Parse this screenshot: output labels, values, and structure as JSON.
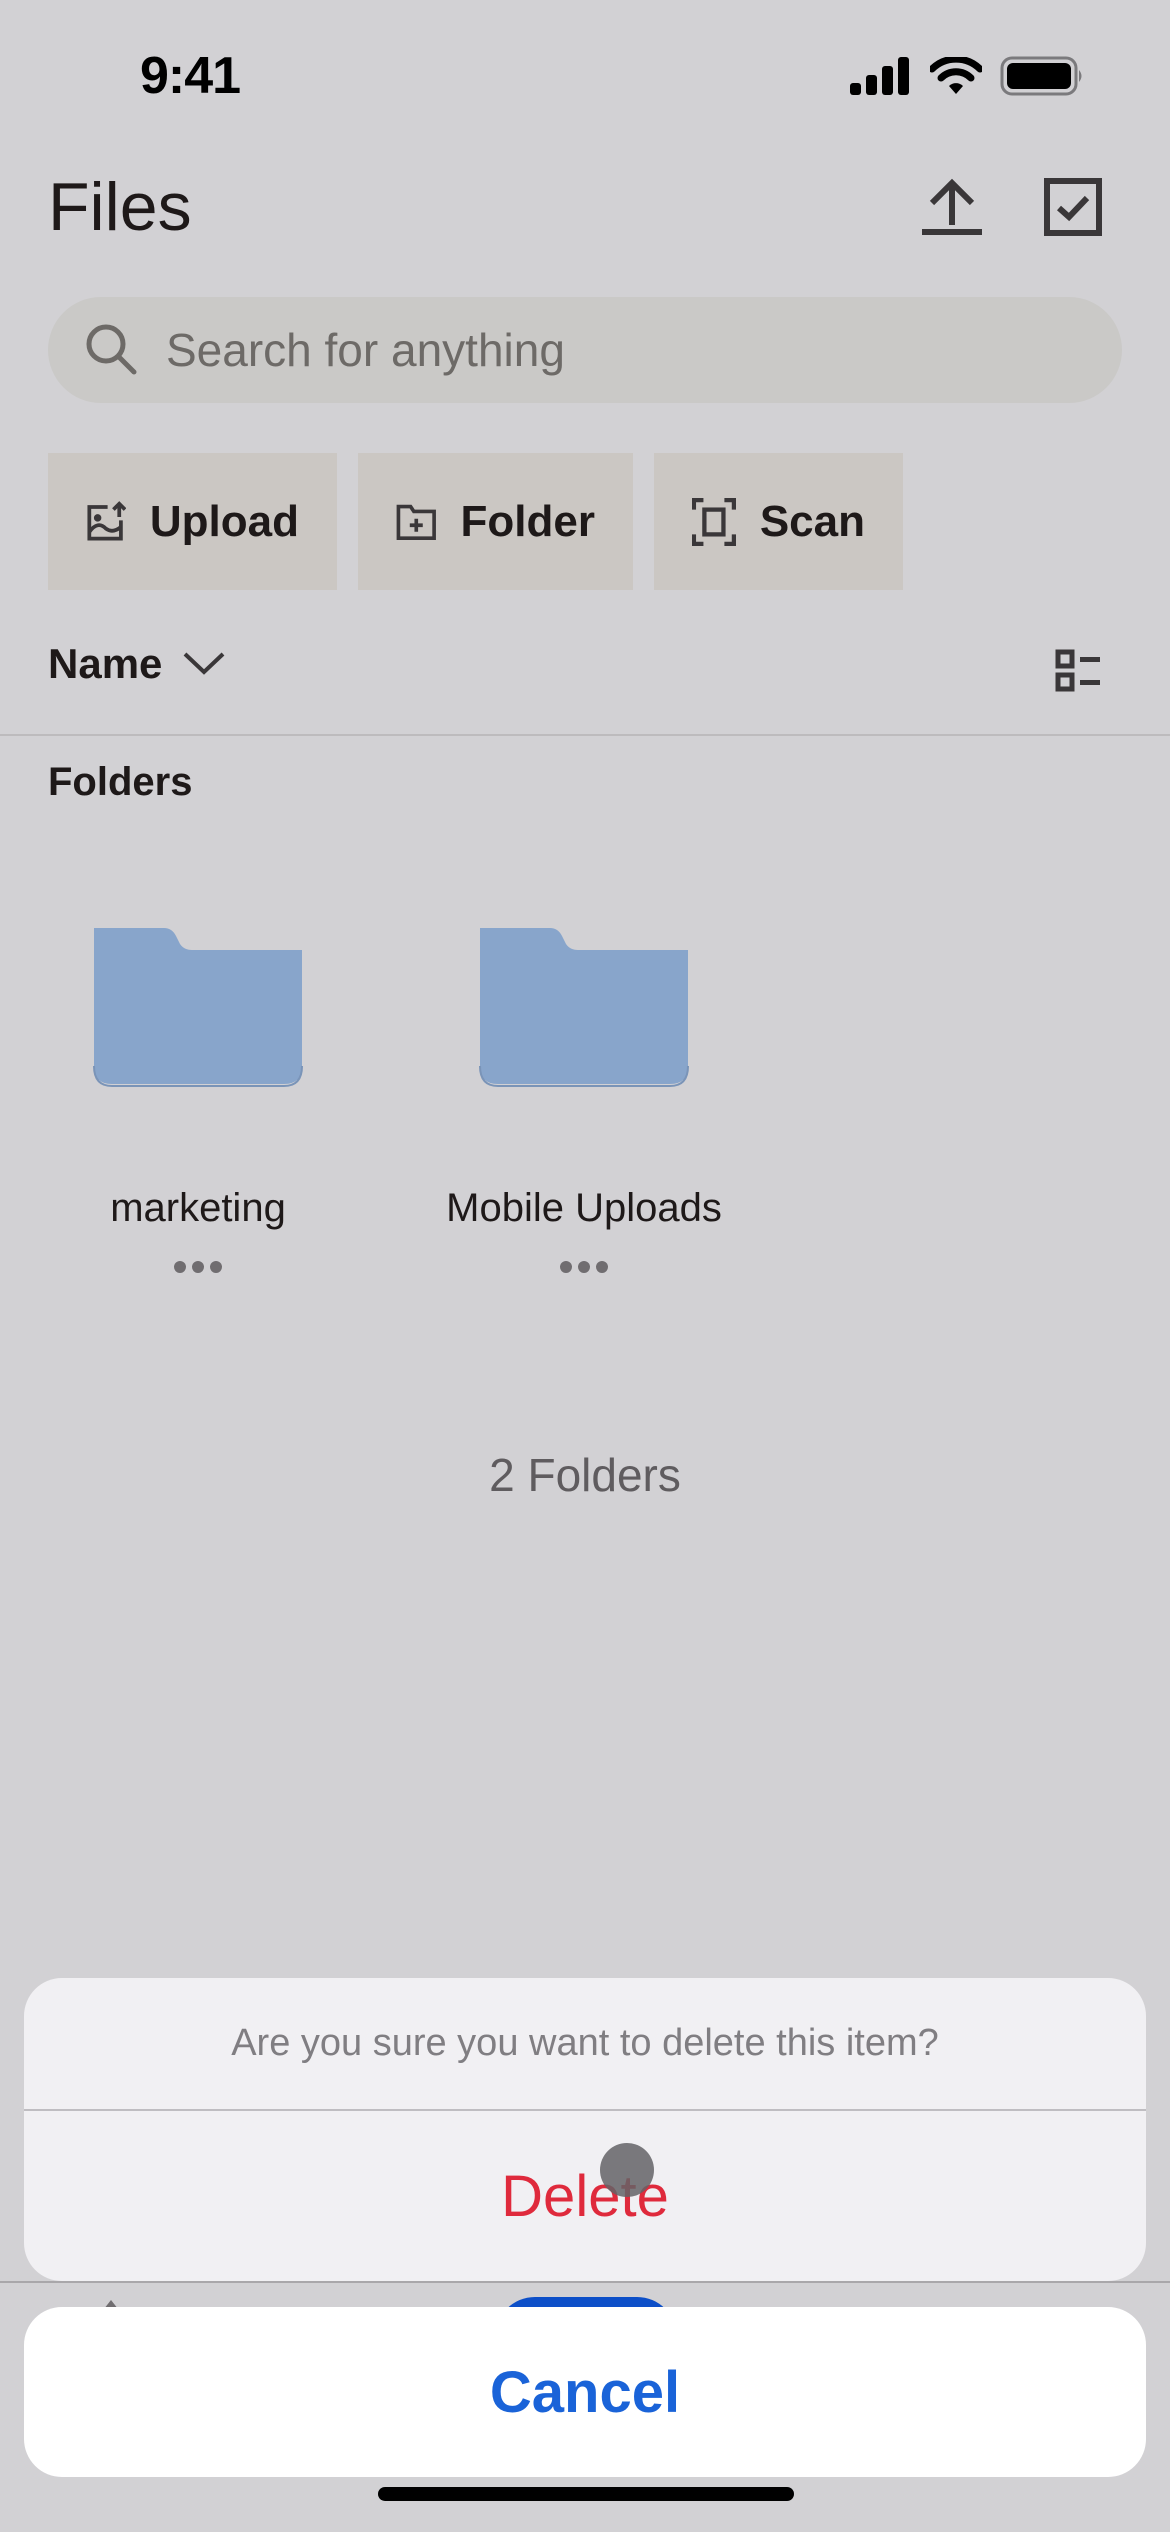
{
  "status_bar": {
    "time": "9:41",
    "icons": [
      "signal-icon",
      "wifi-icon",
      "battery-icon"
    ]
  },
  "header": {
    "title": "Files",
    "actions": [
      "upload-icon",
      "select-checkbox-icon"
    ]
  },
  "search": {
    "placeholder": "Search for anything",
    "value": ""
  },
  "actions": [
    {
      "label": "Upload",
      "icon": "image-upload-icon"
    },
    {
      "label": "Folder",
      "icon": "folder-plus-icon"
    },
    {
      "label": "Scan",
      "icon": "scan-icon"
    }
  ],
  "sort": {
    "label": "Name"
  },
  "sections": {
    "folders_label": "Folders"
  },
  "folders": [
    {
      "name": "marketing"
    },
    {
      "name": "Mobile Uploads"
    }
  ],
  "folder_count": "2 Folders",
  "action_sheet": {
    "message": "Are you sure you want to delete this item?",
    "destructive_label": "Delete",
    "cancel_label": "Cancel"
  },
  "colors": {
    "folder": "#88a5cb",
    "destructive": "#df2a3c",
    "accent": "#1a63d8",
    "background": "#d2d1d4"
  }
}
